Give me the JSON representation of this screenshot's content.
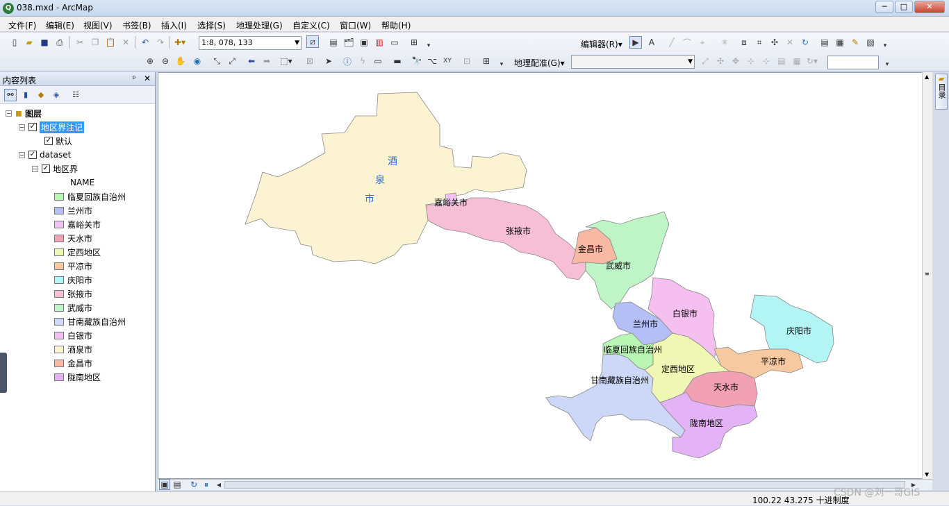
{
  "window": {
    "title": "038.mxd - ArcMap",
    "app_icon": "Q",
    "controls": [
      "─",
      "□",
      "✕"
    ]
  },
  "menu": [
    "文件(F)",
    "编辑(E)",
    "视图(V)",
    "书签(B)",
    "插入(I)",
    "选择(S)",
    "地理处理(G)",
    "自定义(C)",
    "窗口(W)",
    "帮助(H)"
  ],
  "toolbar": {
    "scale": "1:8, 078, 133",
    "editor_label": "编辑器(R)▾",
    "georef_label": "地理配准(G)▾",
    "icons_row1": [
      "new-icon",
      "open-icon",
      "save-icon",
      "print-icon",
      "cut-icon",
      "copy-icon",
      "paste-icon",
      "delete-icon",
      "undo-icon",
      "redo-icon",
      "add-data-icon"
    ],
    "icons_row2": [
      "zoom-in-icon",
      "zoom-out-icon",
      "pan-icon",
      "full-extent-icon",
      "fixed-zoom-in-icon",
      "fixed-zoom-out-icon",
      "back-icon",
      "forward-icon",
      "select-features-icon",
      "select-elements-icon",
      "identify-icon",
      "hyperlink-icon",
      "html-popup-icon",
      "measure-icon",
      "find-icon",
      "find-route-icon",
      "goto-xy-icon"
    ]
  },
  "toc": {
    "title": "内容列表",
    "pin": "ᵖ",
    "close": "✕",
    "root": "图层",
    "annotation_layer": "地区界注记",
    "annotation_class": "默认",
    "dataset": "dataset",
    "feature_layer": "地区界",
    "field": "NAME",
    "legend": [
      {
        "label": "临夏回族自治州",
        "color": "#b9f5b3"
      },
      {
        "label": "兰州市",
        "color": "#b3bff5"
      },
      {
        "label": "嘉峪关市",
        "color": "#f2c2f2"
      },
      {
        "label": "天水市",
        "color": "#f2a0b4"
      },
      {
        "label": "定西地区",
        "color": "#eef7b3"
      },
      {
        "label": "平凉市",
        "color": "#f7c9a0"
      },
      {
        "label": "庆阳市",
        "color": "#b3f5f5"
      },
      {
        "label": "张掖市",
        "color": "#f7bfd6"
      },
      {
        "label": "武威市",
        "color": "#bff5c6"
      },
      {
        "label": "甘南藏族自治州",
        "color": "#cdd7f7"
      },
      {
        "label": "白银市",
        "color": "#f5bff0"
      },
      {
        "label": "酒泉市",
        "color": "#fbf3d2"
      },
      {
        "label": "金昌市",
        "color": "#f7b9a3"
      },
      {
        "label": "陇南地区",
        "color": "#e3b3f5"
      }
    ]
  },
  "map": {
    "labels": {
      "jiuquan": [
        "酒",
        "泉",
        "市"
      ],
      "jiayuguan": "嘉峪关市",
      "zhangye": "张掖市",
      "jinchang": "金昌市",
      "wuwei": "武威市",
      "baiyin": "白银市",
      "lanzhou": "兰州市",
      "qingyang": "庆阳市",
      "linxia": "临夏回族自治州",
      "dingxi": "定西地区",
      "pingliang": "平凉市",
      "gannan": "甘南藏族自治州",
      "tianshui": "天水市",
      "longnan": "陇南地区"
    }
  },
  "status": {
    "coords": "100.22  43.275 十进制度",
    "watermark": "CSDN @刘一哥GIS"
  },
  "catalog_tab": "目录"
}
